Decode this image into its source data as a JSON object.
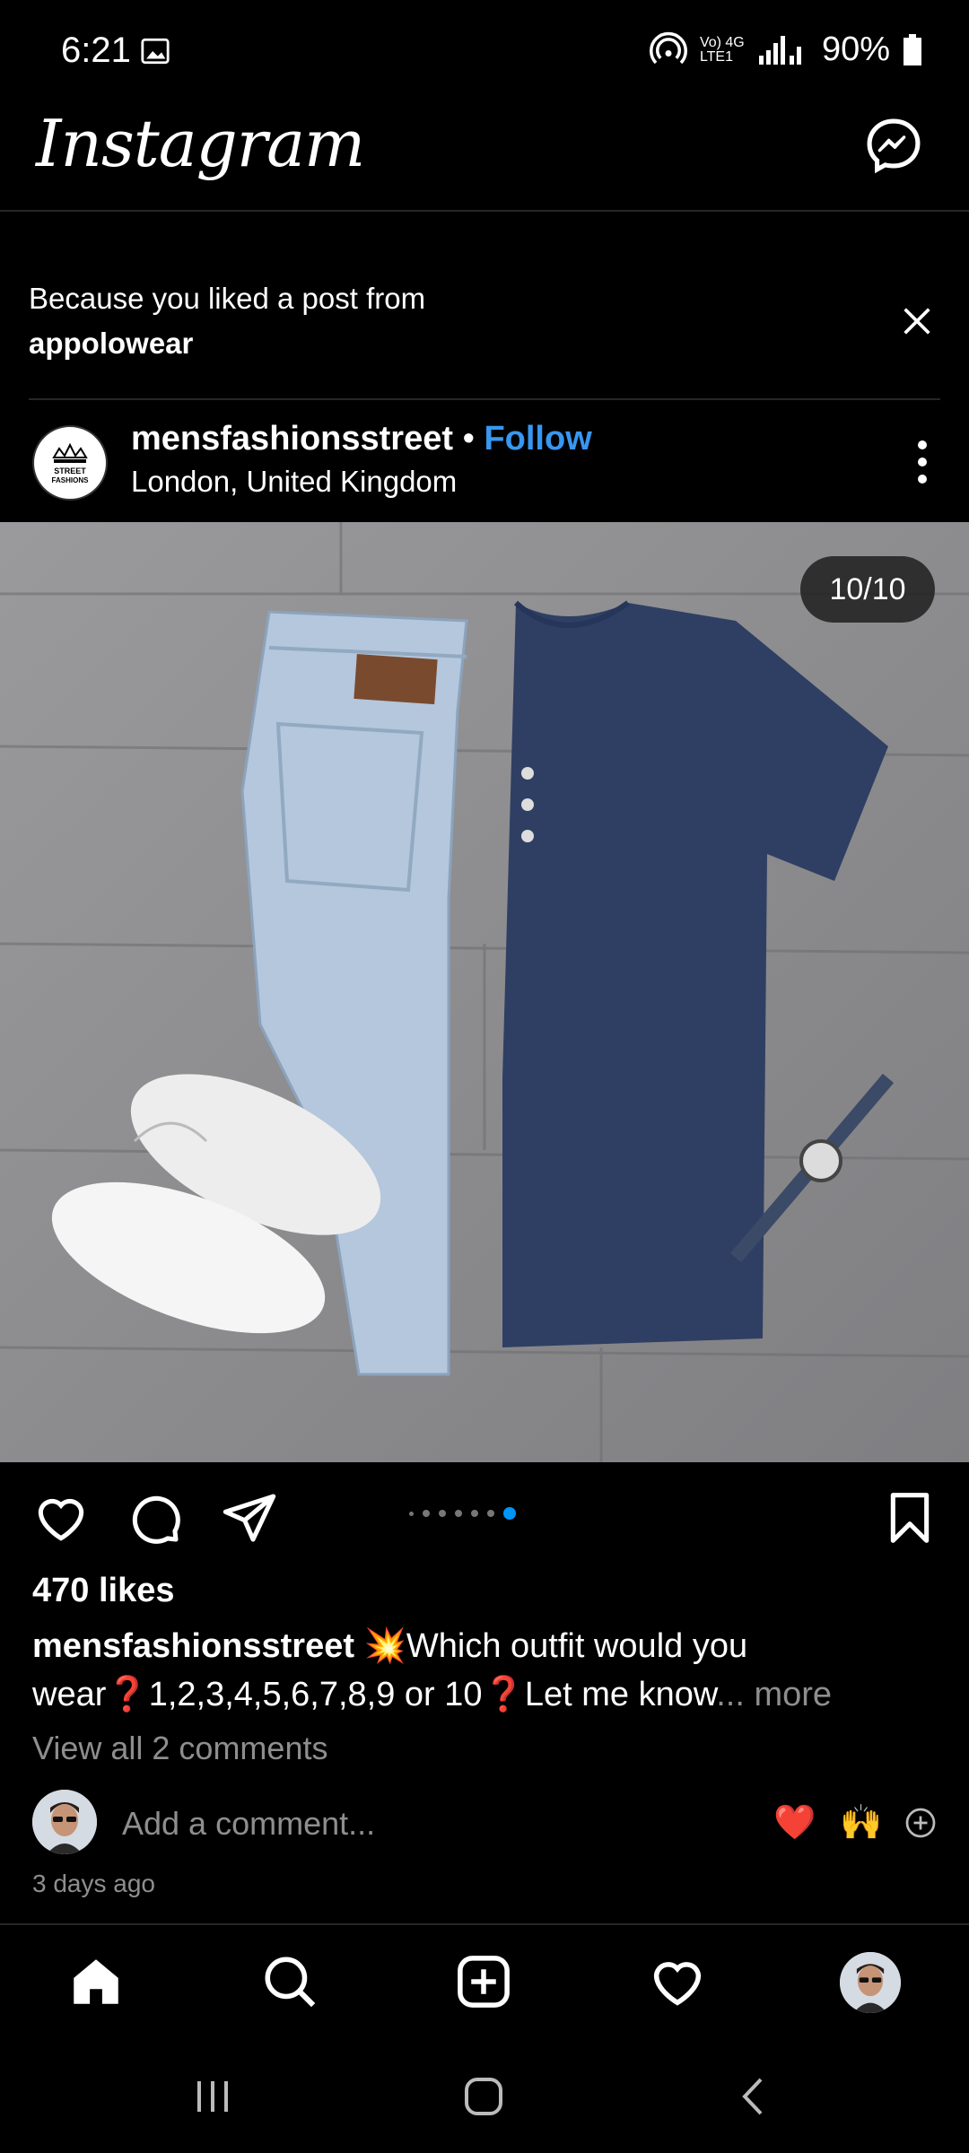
{
  "status": {
    "time": "6:21",
    "network_text": "Vo) 4G LTE1",
    "battery": "90%"
  },
  "header": {
    "logo": "Instagram"
  },
  "suggestion": {
    "line1": "Because you liked a post from",
    "account": "appolowear"
  },
  "post": {
    "brand_logo_line1": "STREET",
    "brand_logo_line2": "FASHIONS",
    "username": "mensfashionsstreet",
    "separator": " • ",
    "follow": "Follow",
    "location": "London, United Kingdom",
    "counter": "10/10",
    "carousel_index": 10,
    "carousel_total": 10,
    "likes": "470 likes",
    "caption_user": "mensfashionsstreet",
    "caption_emoji_1": "💥",
    "caption_text_1": "Which outfit would you",
    "caption_text_2a": "wear",
    "caption_emoji_2": "❓",
    "caption_text_2b": "1,2,3,4,5,6,7,8,9 or 10",
    "caption_emoji_3": "❓",
    "caption_text_2c": "Let me know",
    "caption_ellipsis": "...",
    "more": " more",
    "view_comments": "View all 2 comments",
    "add_comment_placeholder": "Add a comment...",
    "quick_emoji_1": "❤️",
    "quick_emoji_2": "🙌",
    "time_ago": "3 days ago"
  },
  "colors": {
    "background": "#000000",
    "link_blue": "#3897f0",
    "secondary_text": "#8e8e8e",
    "active_dot": "#0095f6"
  },
  "icons": {
    "top_right": "messenger-icon",
    "actions": [
      "heart-icon",
      "comment-icon",
      "share-icon",
      "bookmark-icon"
    ],
    "bottom_nav": [
      "home-icon",
      "search-icon",
      "create-icon",
      "activity-heart-icon",
      "profile-avatar"
    ],
    "system_nav": [
      "recents-icon",
      "home-circle-icon",
      "back-icon"
    ]
  }
}
